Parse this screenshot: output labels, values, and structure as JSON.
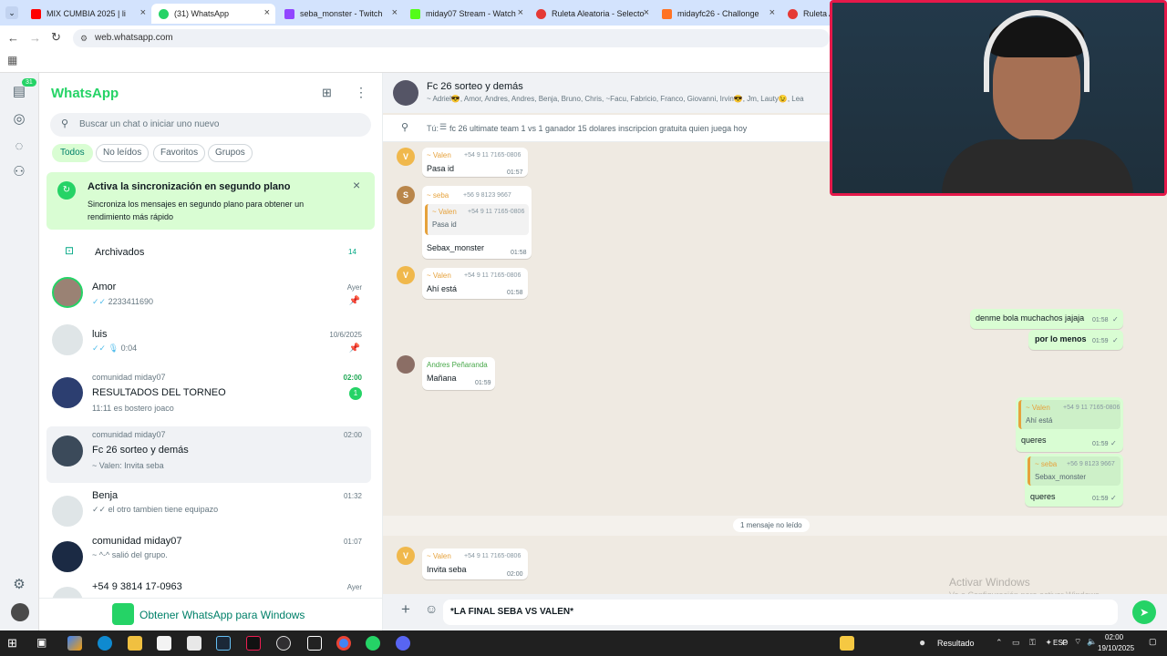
{
  "colors": {
    "wa_green": "#25d366",
    "wa_dark_green": "#00a884",
    "bubble_out": "#d9fdd3",
    "chat_bg": "#efeae2",
    "webcam_border": "#e5194a"
  },
  "tabs": [
    {
      "label": "MIX CUMBIA 2025 | li",
      "icon": "youtube-icon",
      "color": "#ff0000"
    },
    {
      "label": "(31) WhatsApp",
      "icon": "whatsapp-icon",
      "color": "#25d366"
    },
    {
      "label": "seba_monster - Twitch",
      "icon": "twitch-icon",
      "color": "#9146ff"
    },
    {
      "label": "miday07 Stream - Watch",
      "icon": "kick-icon",
      "color": "#53fc18"
    },
    {
      "label": "Ruleta Aleatoria - Selecto",
      "icon": "wheel-icon",
      "color": "#e53935"
    },
    {
      "label": "midayfc26 - Challonge",
      "icon": "challonge-icon",
      "color": "#ff7324"
    },
    {
      "label": "Ruleta A",
      "icon": "wheel-icon",
      "color": "#e53935"
    }
  ],
  "address": {
    "url": "web.whatsapp.com"
  },
  "rail": {
    "badge": "31"
  },
  "sidebar": {
    "title": "WhatsApp",
    "search_placeholder": "Buscar un chat o iniciar uno nuevo",
    "filters": [
      "Todos",
      "No leídos",
      "Favoritos",
      "Grupos"
    ],
    "banner": {
      "title": "Activa la sincronización en segundo plano",
      "line1": "Sincroniza los mensajes en segundo plano para obtener un",
      "line2": "rendimiento más rápido"
    },
    "archived": {
      "label": "Archivados",
      "count": "14"
    },
    "chats": [
      {
        "name": "Amor",
        "preview": "2233411690",
        "time": "Ayer",
        "ticks": "✓✓",
        "pinned": true
      },
      {
        "name": "luis",
        "preview": "0:04",
        "time": "10/6/2025",
        "ticks": "✓✓",
        "pinned": true
      },
      {
        "community": "comunidad miday07",
        "name": "RESULTADOS DEL TORNEO",
        "preview": "11:11 es bostero joaco",
        "time": "02:00",
        "unread": "1"
      },
      {
        "community": "comunidad miday07",
        "name": "Fc 26 sorteo y demás",
        "preview": "~ Valen: Invita seba",
        "time": "02:00"
      },
      {
        "name": "Benja",
        "preview": "el otro tambien tiene equipazo",
        "time": "01:32",
        "ticks": "✓✓"
      },
      {
        "name": "comunidad miday07",
        "preview": "~ ^-^ salió del grupo.",
        "time": "01:07"
      },
      {
        "name": "+54 9 3814 17-0963",
        "preview": "",
        "time": "Ayer"
      }
    ],
    "get_app": "Obtener WhatsApp para Windows"
  },
  "chat": {
    "title": "Fc 26 sorteo y demás",
    "members": "~ Adriel😎, Amor, Andres, Andres, Benja, Bruno, Chris, ~Facu, Fabricio, Franco, Giovanni, Irvin😎, Jm, Lauty😉, Lea",
    "pinned_prefix": "Tú:",
    "pinned_text": "fc 26 ultimate team 1 vs 1 ganador 15 dolares inscripcion gratuita quien juega hoy",
    "messages": {
      "m1": {
        "sender": "~ Valen",
        "phone": "+54 9 11 7165-0806",
        "text": "Pasa id",
        "time": "01:57",
        "avatar": "V"
      },
      "m2": {
        "sender": "~ seba",
        "phone": "+56 9 8123 9667",
        "quote_sender": "~ Valen",
        "quote_phone": "+54 9 11 7165-0806",
        "quote_text": "Pasa id",
        "text": "Sebax_monster",
        "time": "01:58",
        "avatar": "S"
      },
      "m3": {
        "sender": "~ Valen",
        "phone": "+54 9 11 7165-0806",
        "text": "Ahí está",
        "time": "01:58",
        "avatar": "V"
      },
      "o1": {
        "text": "denme bola muchachos jajaja",
        "time": "01:58"
      },
      "o2": {
        "text": "por lo menos",
        "time": "01:59"
      },
      "m4": {
        "sender": "Andres Peñaranda",
        "text": "Mañana",
        "time": "01:59"
      },
      "o3": {
        "quote_sender": "~ Valen",
        "quote_phone": "+54 9 11 7165-0806",
        "quote_text": "Ahí está",
        "text": "queres",
        "time": "01:59"
      },
      "o4": {
        "quote_sender": "~ seba",
        "quote_phone": "+56 9 8123 9667",
        "quote_text": "Sebax_monster",
        "text": "queres",
        "time": "01:59"
      },
      "unread_divider": "1 mensaje no leído",
      "m5": {
        "sender": "~ Valen",
        "phone": "+54 9 11 7165-0806",
        "text": "Invita seba",
        "time": "02:00",
        "avatar": "V"
      }
    },
    "watermark1": "Activar Windows",
    "watermark2": "Ve a Configuración para activar Windows.",
    "composer_value": "*LA FINAL SEBA VS VALEN*"
  },
  "taskbar": {
    "weather": "Resultado",
    "lang": "ESP",
    "time": "02:00",
    "date": "19/10/2025"
  }
}
